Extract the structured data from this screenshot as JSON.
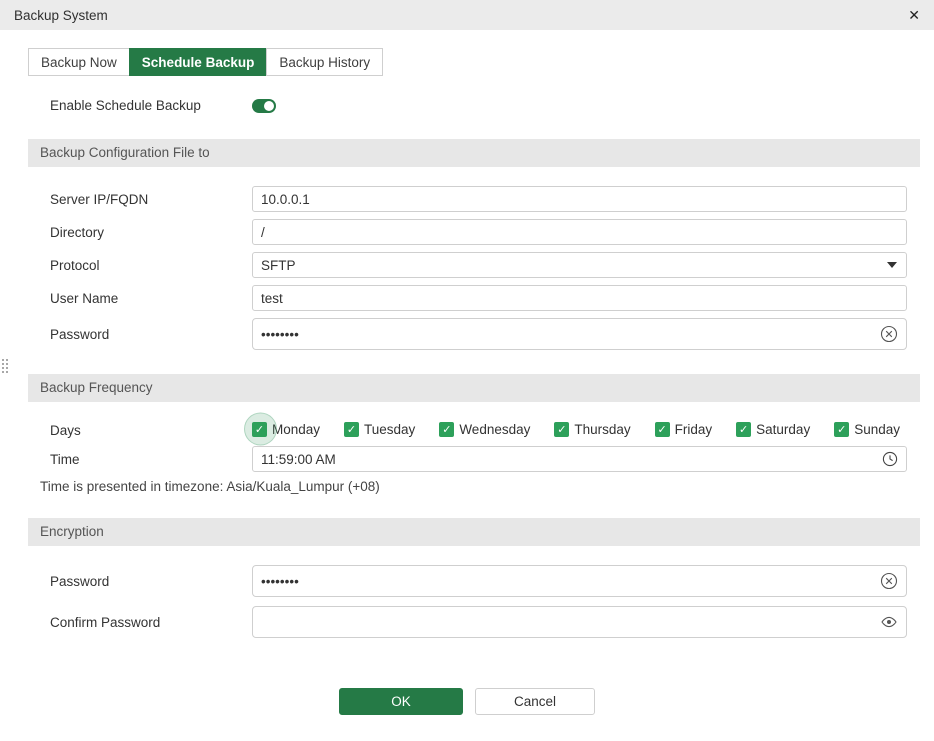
{
  "dialog": {
    "title": "Backup System"
  },
  "tabs": {
    "backup_now": "Backup Now",
    "schedule_backup": "Schedule Backup",
    "backup_history": "Backup History",
    "active": "Schedule Backup"
  },
  "enable": {
    "label": "Enable Schedule Backup",
    "state": "on"
  },
  "config": {
    "header": "Backup Configuration File to",
    "server_label": "Server IP/FQDN",
    "server_value": "10.0.0.1",
    "directory_label": "Directory",
    "directory_value": "/",
    "protocol_label": "Protocol",
    "protocol_value": "SFTP",
    "username_label": "User Name",
    "username_value": "test",
    "password_label": "Password",
    "password_value": "••••••••"
  },
  "frequency": {
    "header": "Backup Frequency",
    "days_label": "Days",
    "days": [
      {
        "label": "Monday",
        "checked": true,
        "highlighted": true
      },
      {
        "label": "Tuesday",
        "checked": true
      },
      {
        "label": "Wednesday",
        "checked": true
      },
      {
        "label": "Thursday",
        "checked": true
      },
      {
        "label": "Friday",
        "checked": true
      },
      {
        "label": "Saturday",
        "checked": true
      },
      {
        "label": "Sunday",
        "checked": true
      }
    ],
    "time_label": "Time",
    "time_value": "11:59:00 AM",
    "timezone_note": "Time is presented in timezone: Asia/Kuala_Lumpur (+08)"
  },
  "encryption": {
    "header": "Encryption",
    "password_label": "Password",
    "password_value": "••••••••",
    "confirm_label": "Confirm Password",
    "confirm_value": ""
  },
  "footer": {
    "ok_label": "OK",
    "cancel_label": "Cancel"
  },
  "colors": {
    "accent_green": "#257a46",
    "checkbox_green": "#2da05a",
    "header_bg": "#e7e7e7"
  }
}
